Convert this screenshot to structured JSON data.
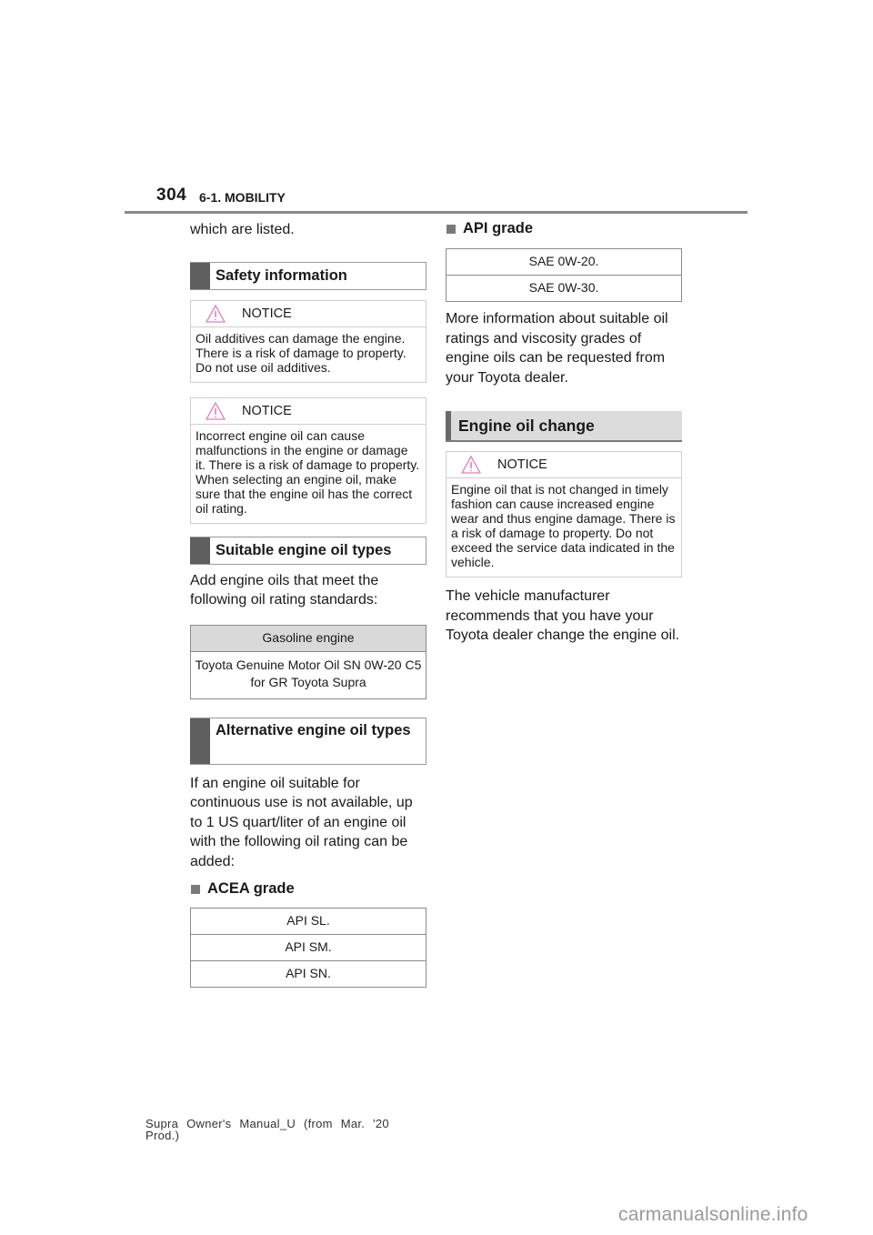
{
  "header": {
    "page_number": "304",
    "section": "6-1. MOBILITY"
  },
  "left": {
    "intro_text": "which are listed.",
    "safety_heading": "Safety information",
    "notice1": {
      "label": "NOTICE",
      "text": "Oil additives can damage the engine. There is a risk of damage to property. Do not use oil additives."
    },
    "notice2": {
      "label": "NOTICE",
      "text": "Incorrect engine oil can cause malfunctions in the engine or damage it. There is a risk of damage to property. When selecting an engine oil, make sure that the engine oil has the correct oil rating."
    },
    "suitable_heading": "Suitable engine oil types",
    "suitable_text": "Add engine oils that meet the following oil rating standards:",
    "gasoline_table": {
      "header": "Gasoline engine",
      "value": "Toyota Genuine Motor Oil SN 0W-20 C5 for GR Toyota Supra"
    },
    "alternative_heading": "Alternative engine oil types",
    "alternative_text": "If an engine oil suitable for continuous use is not available, up to 1 US quart/liter of an engine oil with the following oil rating can be added:",
    "acea_heading": "ACEA grade",
    "acea_rows": [
      "API SL.",
      "API SM.",
      "API SN."
    ]
  },
  "right": {
    "api_heading": "API grade",
    "api_rows": [
      "SAE 0W-20.",
      "SAE 0W-30."
    ],
    "more_info_text": "More information about suitable oil ratings and viscosity grades of engine oils can be requested from your Toyota dealer.",
    "oil_change_heading": "Engine oil change",
    "notice3": {
      "label": "NOTICE",
      "text": "Engine oil that is not changed in timely fashion can cause increased engine wear and thus engine damage. There is a risk of damage to property. Do not exceed the service data indicated in the vehicle."
    },
    "recommend_text": "The vehicle manufacturer recommends that you have your Toyota dealer change the engine oil."
  },
  "footer": {
    "manual_label": "Supra Owner's Manual_U (from Mar. '20 Prod.)"
  },
  "watermark": "carmanualsonline.info",
  "colors": {
    "warning_triangle": "#e87fb8",
    "heading_bar": "#5f5f5f",
    "table_header_bg": "#d9d9d9"
  }
}
